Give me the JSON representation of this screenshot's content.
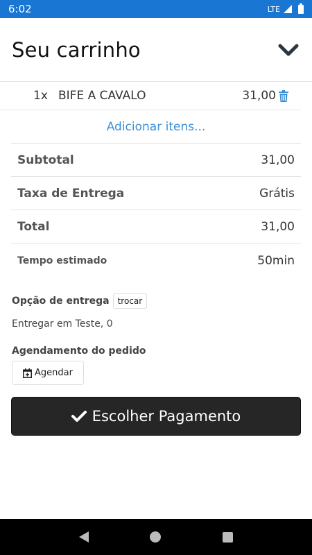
{
  "status_bar": {
    "time": "6:02",
    "network": "LTE"
  },
  "header": {
    "title": "Seu carrinho",
    "collapse_icon": "chevron-down-icon"
  },
  "cart": {
    "items": [
      {
        "qty": "1x",
        "name": "BIFE A CAVALO",
        "price": "31,00",
        "delete_icon": "trash-icon"
      }
    ],
    "add_items_label": "Adicionar itens..."
  },
  "summary": {
    "subtotal": {
      "label": "Subtotal",
      "value": "31,00"
    },
    "delivery_fee": {
      "label": "Taxa de Entrega",
      "value": "Grátis"
    },
    "total": {
      "label": "Total",
      "value": "31,00"
    },
    "estimated_time": {
      "label": "Tempo estimado",
      "value": "50min"
    }
  },
  "delivery": {
    "label": "Opção de entrega",
    "swap_label": "trocar",
    "address": "Entregar em Teste, 0"
  },
  "schedule": {
    "label": "Agendamento do pedido",
    "button_label": "Agendar",
    "icon": "calendar-plus-icon"
  },
  "payment": {
    "button_label": "Escolher Pagamento",
    "icon": "check-icon"
  },
  "colors": {
    "status_bar": "#1976d2",
    "link": "#3a8fd6",
    "pay_button": "#262626"
  }
}
